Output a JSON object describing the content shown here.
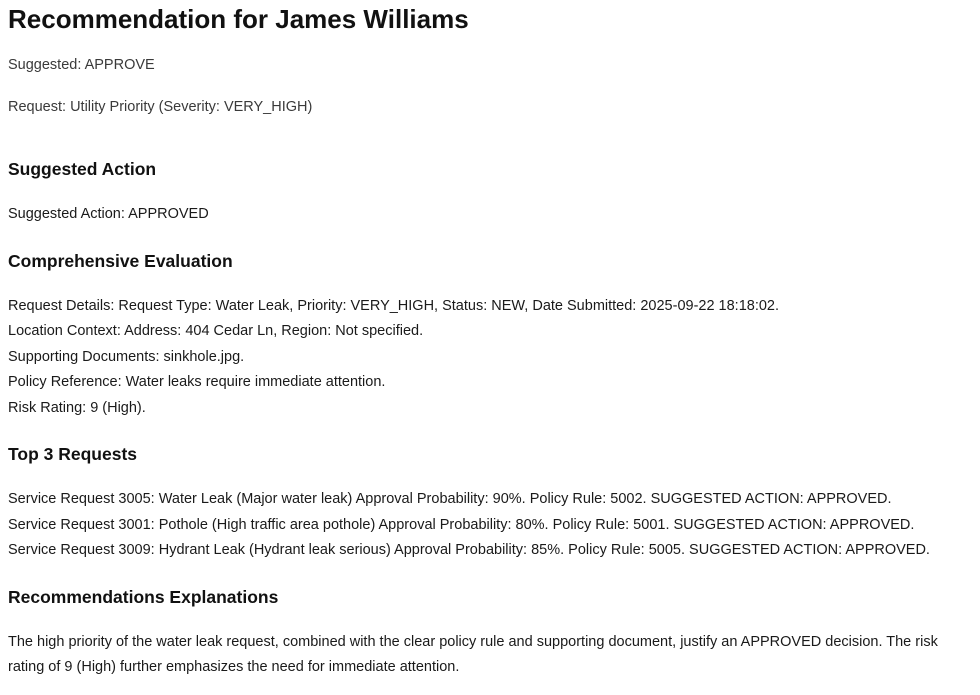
{
  "title": "Recommendation for James Williams",
  "suggested": "Suggested: APPROVE",
  "request": "Request: Utility Priority (Severity: VERY_HIGH)",
  "sections": {
    "suggested_action": {
      "heading": "Suggested Action",
      "text": "Suggested Action: APPROVED"
    },
    "evaluation": {
      "heading": "Comprehensive Evaluation",
      "lines": [
        "Request Details: Request Type: Water Leak, Priority: VERY_HIGH, Status: NEW, Date Submitted: 2025-09-22 18:18:02.",
        "Location Context: Address: 404 Cedar Ln, Region: Not specified.",
        "Supporting Documents: sinkhole.jpg.",
        "Policy Reference: Water leaks require immediate attention.",
        "Risk Rating: 9 (High)."
      ]
    },
    "top_requests": {
      "heading": "Top 3 Requests",
      "lines": [
        "Service Request 3005: Water Leak (Major water leak) Approval Probability: 90%. Policy Rule: 5002. SUGGESTED ACTION: APPROVED.",
        "Service Request 3001: Pothole (High traffic area pothole) Approval Probability: 80%. Policy Rule: 5001. SUGGESTED ACTION: APPROVED.",
        "Service Request 3009: Hydrant Leak (Hydrant leak serious) Approval Probability: 85%. Policy Rule: 5005. SUGGESTED ACTION: APPROVED."
      ]
    },
    "explanations": {
      "heading": "Recommendations Explanations",
      "text": "The high priority of the water leak request, combined with the clear policy rule and supporting document, justify an APPROVED decision. The risk rating of 9 (High) further emphasizes the need for immediate attention."
    }
  }
}
